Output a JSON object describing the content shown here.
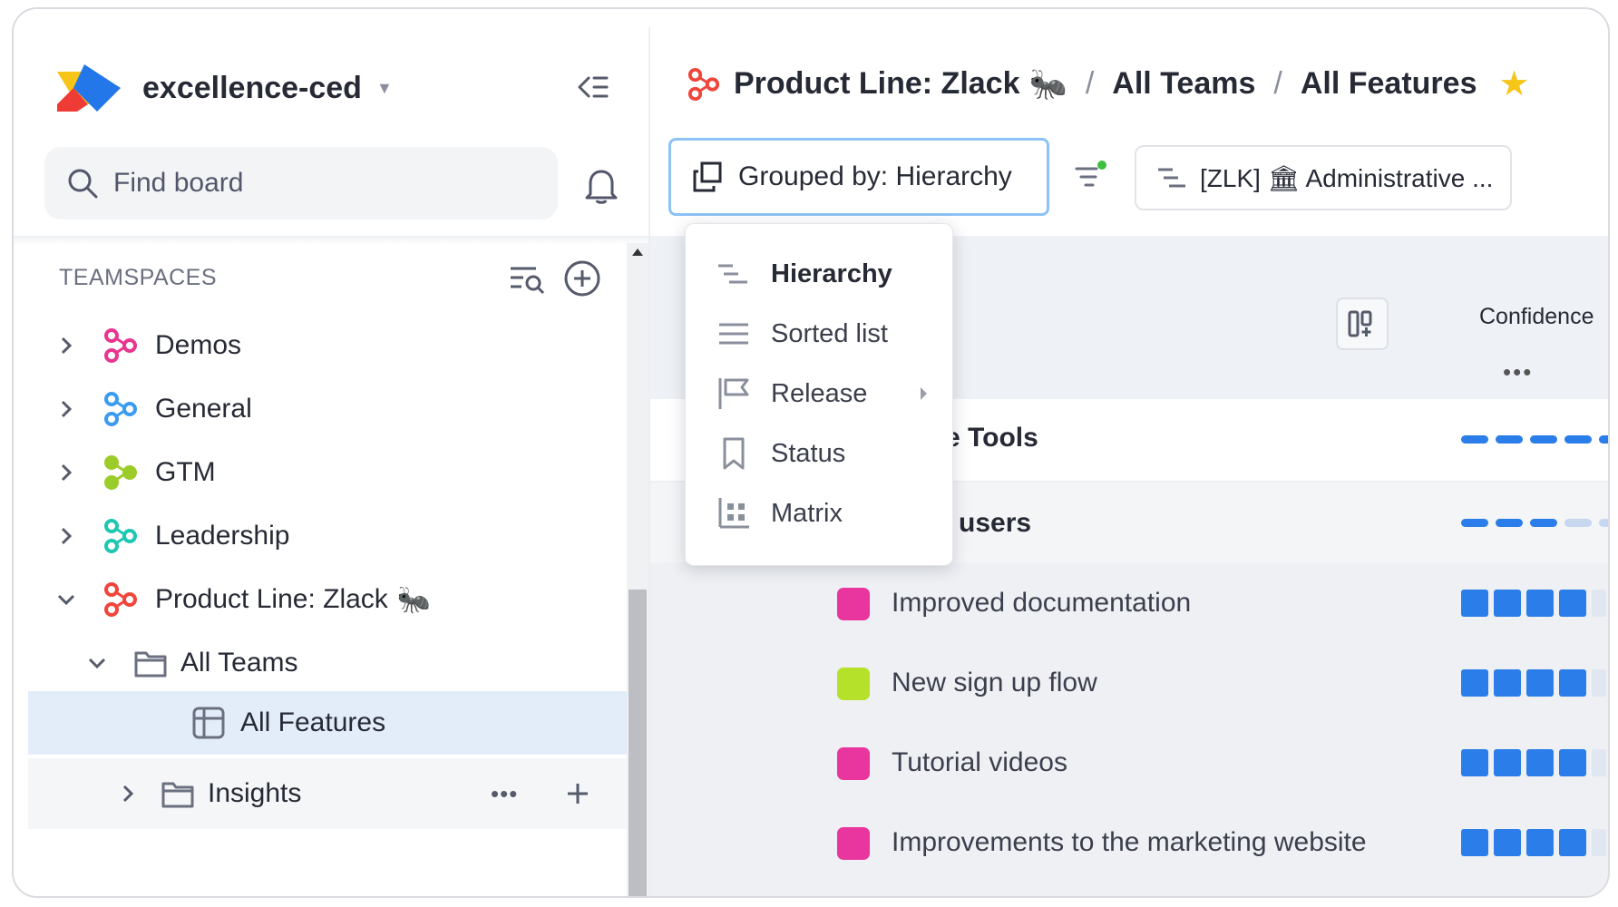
{
  "workspace": {
    "name": "excellence-ced"
  },
  "search": {
    "placeholder": "Find board"
  },
  "teamspaces": {
    "header": "TEAMSPACES",
    "items": [
      {
        "label": "Demos",
        "color": "#e8368f"
      },
      {
        "label": "General",
        "color": "#3b9bf0"
      },
      {
        "label": "GTM",
        "color": "#9ccc2a"
      },
      {
        "label": "Leadership",
        "color": "#1dc7b2"
      },
      {
        "label": "Product Line: Zlack",
        "emoji": "🐜",
        "color": "#f0453a"
      }
    ],
    "folders": [
      {
        "label": "All Teams"
      },
      {
        "label": "All Features"
      },
      {
        "label": "Insights"
      }
    ]
  },
  "breadcrumb": {
    "items": [
      "Product Line: Zlack",
      "All Teams",
      "All Features"
    ],
    "emoji": "🐜",
    "separator": "/"
  },
  "toolbar": {
    "group_label": "Grouped by: Hierarchy",
    "filter_label": "[ZLK] 🏛 Administrative ..."
  },
  "dropdown": {
    "items": [
      {
        "label": "Hierarchy",
        "icon": "hierarchy-icon",
        "active": true
      },
      {
        "label": "Sorted list",
        "icon": "list-icon"
      },
      {
        "label": "Release",
        "icon": "flag-icon",
        "submenu": true
      },
      {
        "label": "Status",
        "icon": "bookmark-icon"
      },
      {
        "label": "Matrix",
        "icon": "matrix-icon"
      }
    ]
  },
  "grid": {
    "column_header": "Confidence",
    "column_more": "•••",
    "rows": [
      {
        "label": "inistrative Tools",
        "confidence": 0.95
      },
      {
        "label": "oard new users",
        "confidence": 0.75
      }
    ],
    "features": [
      {
        "label": "Improved documentation",
        "color": "#e8369e",
        "confidence": 4
      },
      {
        "label": "New sign up flow",
        "color": "#b6e12a",
        "confidence": 4
      },
      {
        "label": "Tutorial videos",
        "color": "#e8369e",
        "confidence": 4
      },
      {
        "label": "Improvements to the marketing website",
        "color": "#e8369e",
        "confidence": 4
      }
    ]
  },
  "sidebar_more": "•••",
  "accent": "#2b7de9"
}
